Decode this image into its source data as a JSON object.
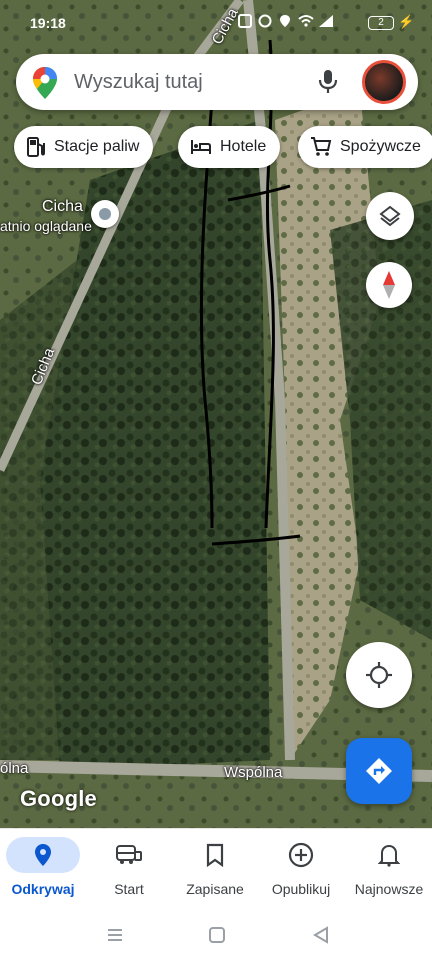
{
  "status_bar": {
    "time": "19:18",
    "battery": "2"
  },
  "search": {
    "placeholder": "Wyszukaj tutaj"
  },
  "chips": [
    {
      "label": "Stacje paliw",
      "icon": "gas-station-icon"
    },
    {
      "label": "Hotele",
      "icon": "bed-icon"
    },
    {
      "label": "Spożywcze",
      "icon": "shopping-cart-icon"
    }
  ],
  "map": {
    "place_name": "Cicha",
    "place_subtitle": "atnio oglądane",
    "roads": {
      "cicha_top": "Cicha",
      "cicha_left": "Cicha",
      "wspolna": "Wspólna",
      "wspolna_left": "ólna"
    },
    "attribution": "Google"
  },
  "bottom_nav": [
    {
      "label": "Odkrywaj",
      "icon": "location-pin-icon",
      "active": true
    },
    {
      "label": "Start",
      "icon": "car-icon",
      "active": false
    },
    {
      "label": "Zapisane",
      "icon": "bookmark-icon",
      "active": false
    },
    {
      "label": "Opublikuj",
      "icon": "add-circle-icon",
      "active": false
    },
    {
      "label": "Najnowsze",
      "icon": "bell-icon",
      "active": false
    }
  ],
  "colors": {
    "accent": "#1a73e8",
    "nav_active_bg": "#d3e3fd",
    "nav_active_text": "#0b57d0"
  }
}
